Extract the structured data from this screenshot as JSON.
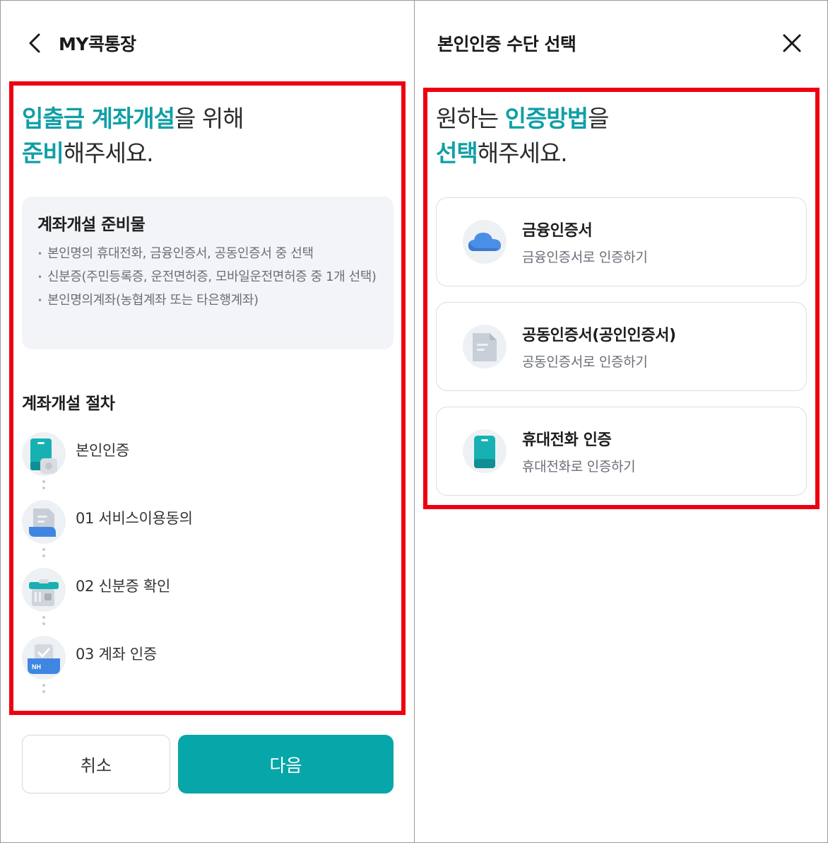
{
  "left_screen": {
    "title": "MY콕통장",
    "headline": {
      "line1_accent": "입출금 계좌개설",
      "line1_rest": "을 위해",
      "line2_accent": "준비",
      "line2_rest": "해주세요."
    },
    "prep_card": {
      "title": "계좌개설 준비물",
      "items": [
        "본인명의 휴대전화, 금융인증서, 공동인증서 중 선택",
        "신분증(주민등록증, 운전면허증, 모바일운전면허증 중 1개 선택)",
        "본인명의계좌(농협계좌 또는 타은행계좌)"
      ]
    },
    "steps_title": "계좌개설 절차",
    "steps": [
      {
        "label": "본인인증",
        "icon": "phone-auth-icon"
      },
      {
        "label": "01  서비스이용동의",
        "icon": "document-consent-icon"
      },
      {
        "label": "02  신분증 확인",
        "icon": "id-card-icon"
      },
      {
        "label": "03  계좌 인증",
        "icon": "nh-account-icon",
        "icon_text": "NH"
      }
    ],
    "buttons": {
      "cancel": "취소",
      "next": "다음"
    }
  },
  "right_screen": {
    "title": "본인인증 수단 선택",
    "headline": {
      "line1_start": "원하는 ",
      "line1_accent": "인증방법",
      "line1_rest": "을",
      "line2_accent": "선택",
      "line2_rest": "해주세요."
    },
    "methods": [
      {
        "name": "금융인증서",
        "desc": "금융인증서로 인증하기",
        "icon": "cloud-icon"
      },
      {
        "name": "공동인증서(공인인증서)",
        "desc": "공동인증서로 인증하기",
        "icon": "document-icon"
      },
      {
        "name": "휴대전화 인증",
        "desc": "휴대전화로 인증하기",
        "icon": "phone-icon"
      }
    ]
  },
  "colors": {
    "accent": "#109fa6",
    "primary_button": "#07a6a9",
    "highlight_box": "#ee0010",
    "card_background": "#f3f4f7"
  }
}
